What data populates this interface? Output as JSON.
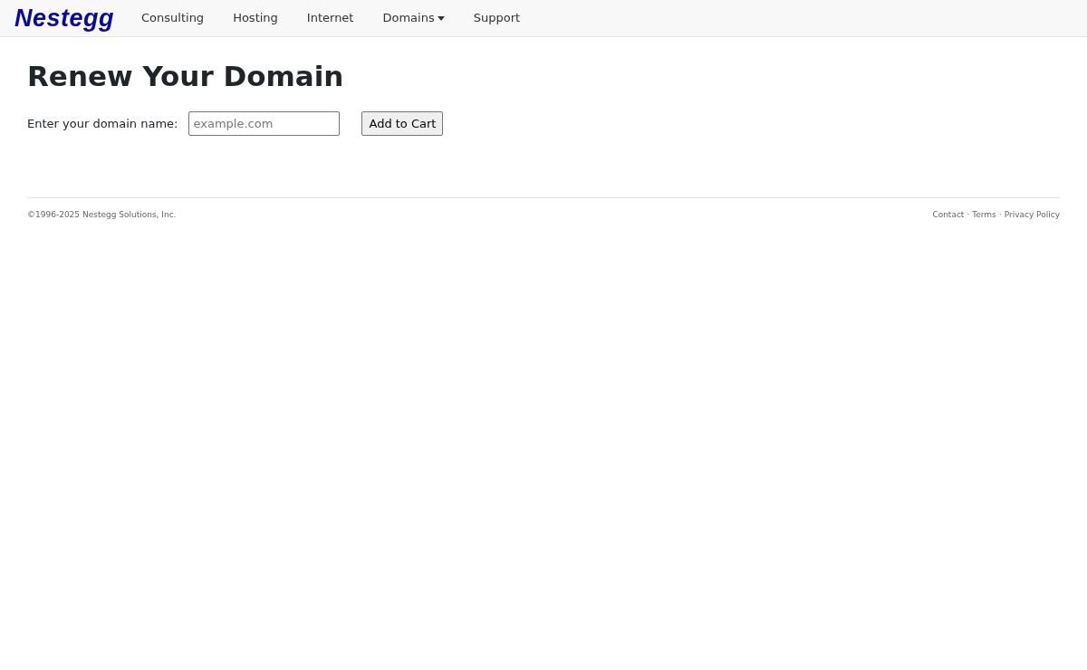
{
  "navbar": {
    "brand": "Nestegg",
    "items": [
      {
        "label": "Consulting",
        "kind": "link"
      },
      {
        "label": "Hosting",
        "kind": "link"
      },
      {
        "label": "Internet",
        "kind": "link"
      },
      {
        "label": "Domains",
        "kind": "dropdown"
      },
      {
        "label": "Support",
        "kind": "link"
      }
    ]
  },
  "heading": "Renew Your Domain",
  "form": {
    "label": "Enter your domain name:",
    "placeholder": "example.com",
    "button": "Add to Cart"
  },
  "footer": {
    "copyright": "©1996-2025 Nestegg Solutions, Inc.",
    "links": [
      "Contact",
      "Terms",
      "Privacy Policy"
    ],
    "separators": [
      "·",
      "·"
    ]
  }
}
